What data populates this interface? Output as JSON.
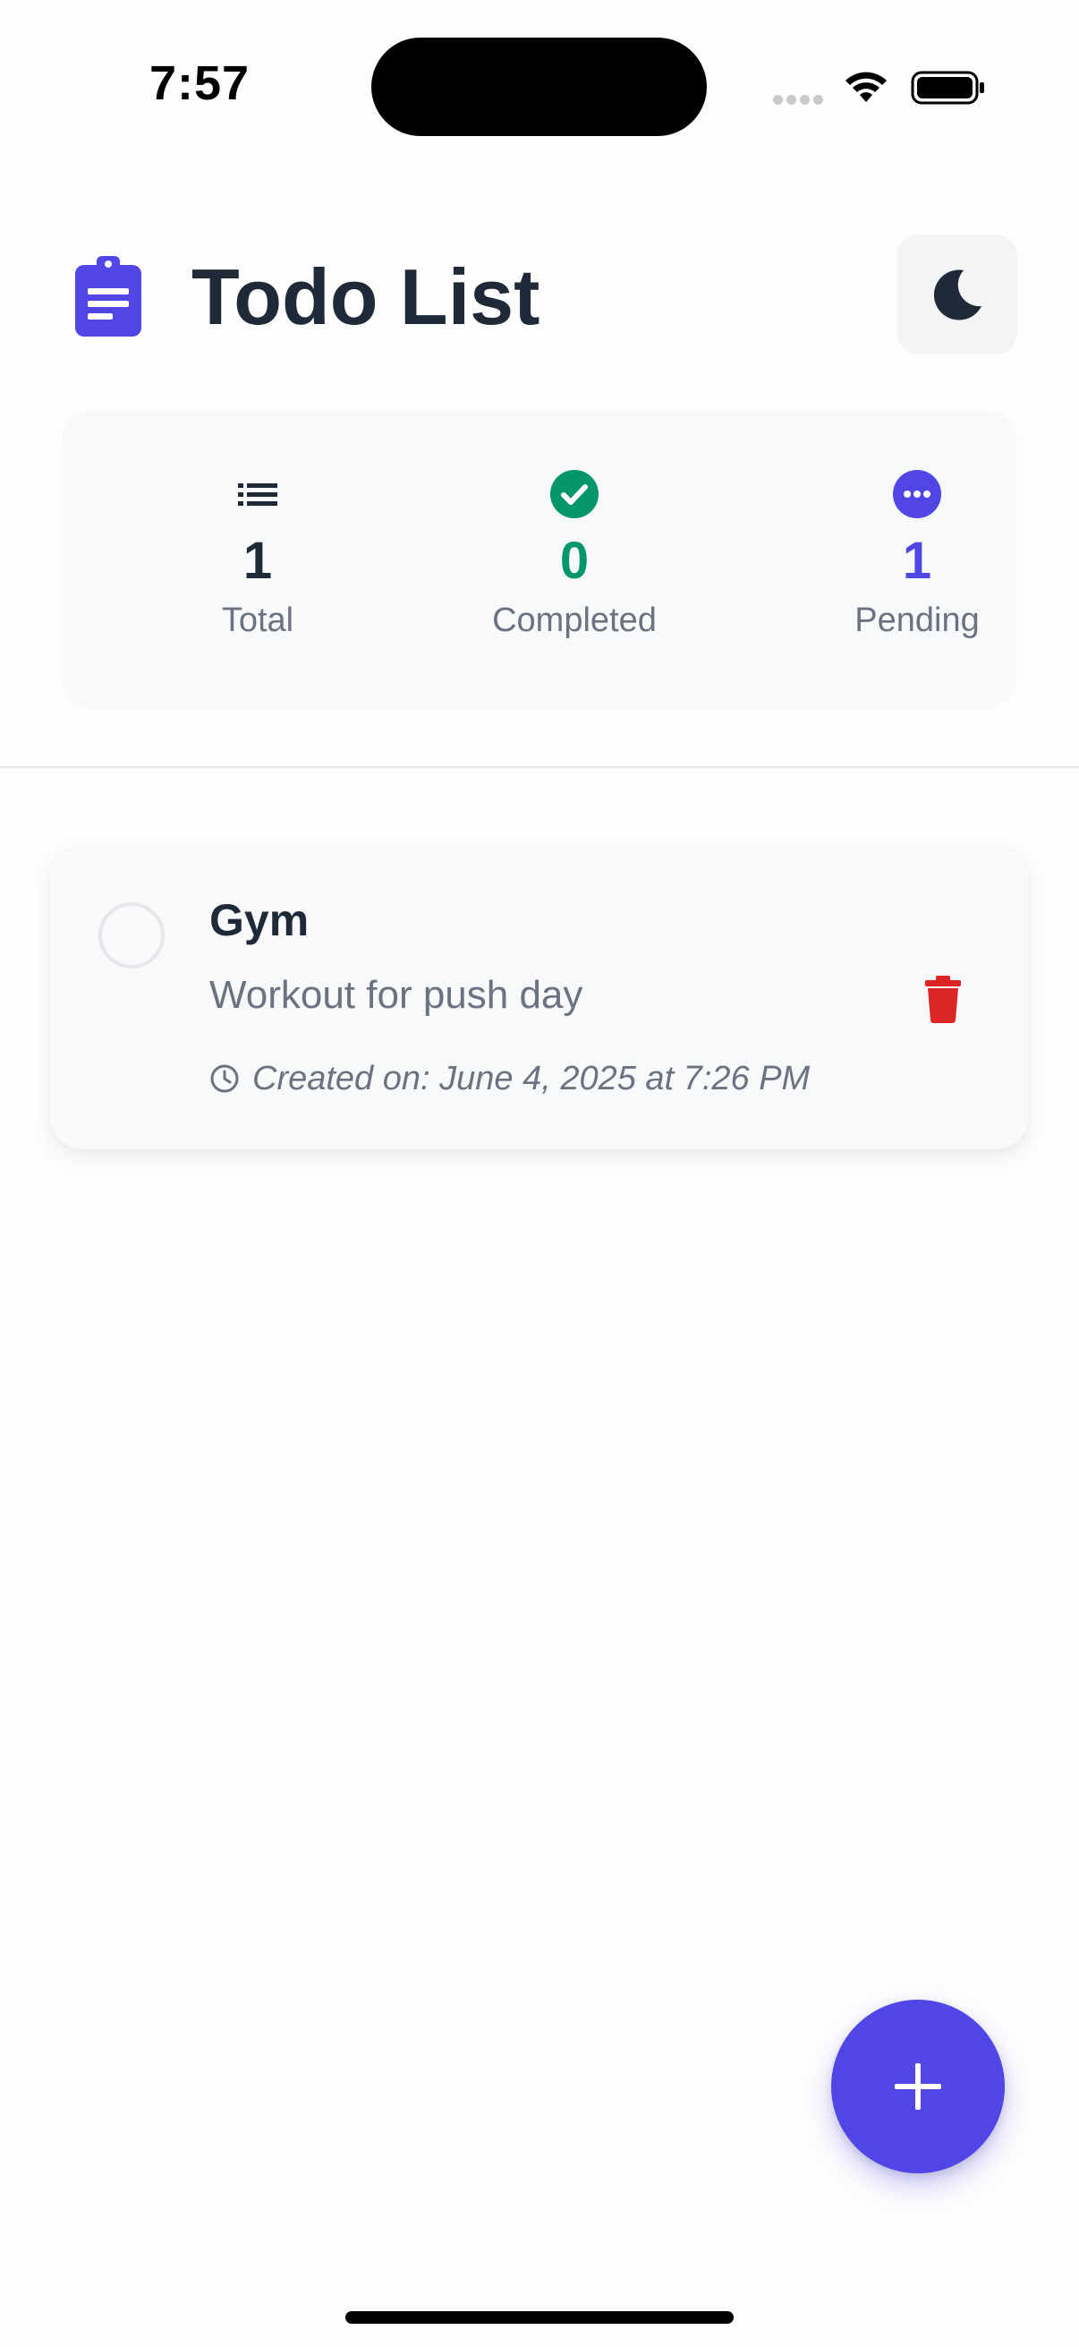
{
  "status_bar": {
    "time": "7:57"
  },
  "header": {
    "title": "Todo List",
    "icon": "clipboard-list-icon",
    "theme_toggle_icon": "moon-icon"
  },
  "stats": {
    "total": {
      "value": "1",
      "label": "Total",
      "icon": "list-icon"
    },
    "completed": {
      "value": "0",
      "label": "Completed",
      "icon": "check-circle-icon",
      "color": "#059669"
    },
    "pending": {
      "value": "1",
      "label": "Pending",
      "icon": "ellipsis-circle-icon",
      "color": "#4f46e5"
    }
  },
  "tasks": [
    {
      "title": "Gym",
      "description": "Workout for push day",
      "created": "Created on: June 4, 2025 at 7:26 PM",
      "completed": false
    }
  ],
  "fab": {
    "icon": "plus-icon"
  },
  "colors": {
    "accent": "#4f46e5",
    "success": "#059669",
    "danger": "#dc2626",
    "text": "#1f2937",
    "muted": "#6b7280"
  }
}
